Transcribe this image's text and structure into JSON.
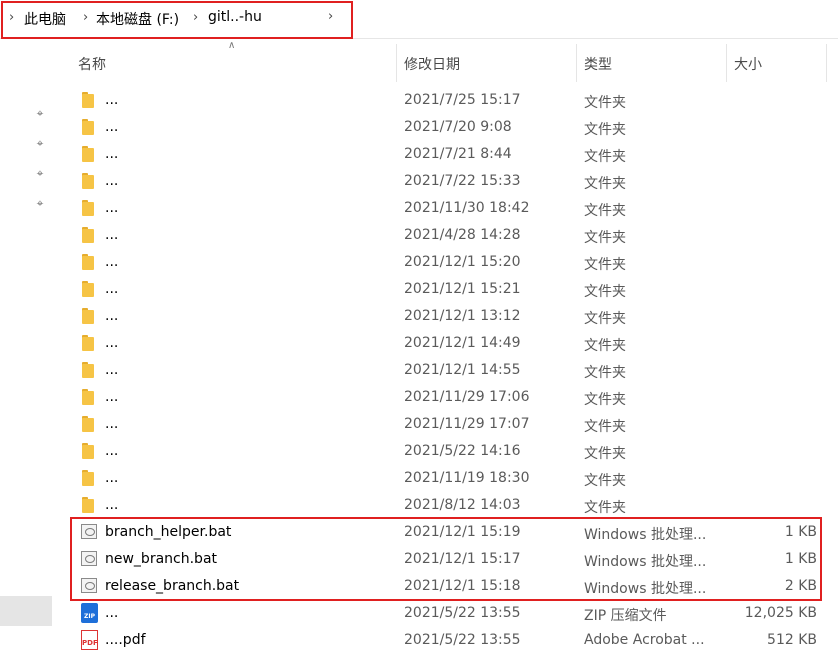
{
  "breadcrumb": {
    "items": [
      "此电脑",
      "本地磁盘 (F:)",
      "gitl..-hu"
    ]
  },
  "columns": {
    "name": "名称",
    "date": "修改日期",
    "type": "类型",
    "size": "大小"
  },
  "files": [
    {
      "name": "...",
      "date": "2021/7/25 15:17",
      "type": "文件夹",
      "size": "",
      "kind": "folder"
    },
    {
      "name": "...",
      "date": "2021/7/20 9:08",
      "type": "文件夹",
      "size": "",
      "kind": "folder"
    },
    {
      "name": "...",
      "date": "2021/7/21 8:44",
      "type": "文件夹",
      "size": "",
      "kind": "folder"
    },
    {
      "name": "...",
      "date": "2021/7/22 15:33",
      "type": "文件夹",
      "size": "",
      "kind": "folder"
    },
    {
      "name": "...",
      "date": "2021/11/30 18:42",
      "type": "文件夹",
      "size": "",
      "kind": "folder"
    },
    {
      "name": "...",
      "date": "2021/4/28 14:28",
      "type": "文件夹",
      "size": "",
      "kind": "folder"
    },
    {
      "name": "...",
      "date": "2021/12/1 15:20",
      "type": "文件夹",
      "size": "",
      "kind": "folder"
    },
    {
      "name": "...",
      "date": "2021/12/1 15:21",
      "type": "文件夹",
      "size": "",
      "kind": "folder"
    },
    {
      "name": "...",
      "date": "2021/12/1 13:12",
      "type": "文件夹",
      "size": "",
      "kind": "folder"
    },
    {
      "name": "...",
      "date": "2021/12/1 14:49",
      "type": "文件夹",
      "size": "",
      "kind": "folder"
    },
    {
      "name": "...",
      "date": "2021/12/1 14:55",
      "type": "文件夹",
      "size": "",
      "kind": "folder"
    },
    {
      "name": "...",
      "date": "2021/11/29 17:06",
      "type": "文件夹",
      "size": "",
      "kind": "folder"
    },
    {
      "name": "...",
      "date": "2021/11/29 17:07",
      "type": "文件夹",
      "size": "",
      "kind": "folder"
    },
    {
      "name": "...",
      "date": "2021/5/22 14:16",
      "type": "文件夹",
      "size": "",
      "kind": "folder"
    },
    {
      "name": "...",
      "date": "2021/11/19 18:30",
      "type": "文件夹",
      "size": "",
      "kind": "folder"
    },
    {
      "name": "...",
      "date": "2021/8/12 14:03",
      "type": "文件夹",
      "size": "",
      "kind": "folder"
    },
    {
      "name": "branch_helper.bat",
      "date": "2021/12/1 15:19",
      "type": "Windows 批处理...",
      "size": "1 KB",
      "kind": "bat"
    },
    {
      "name": "new_branch.bat",
      "date": "2021/12/1 15:17",
      "type": "Windows 批处理...",
      "size": "1 KB",
      "kind": "bat"
    },
    {
      "name": "release_branch.bat",
      "date": "2021/12/1 15:18",
      "type": "Windows 批处理...",
      "size": "2 KB",
      "kind": "bat"
    },
    {
      "name": "...",
      "date": "2021/5/22 13:55",
      "type": "ZIP 压缩文件",
      "size": "12,025 KB",
      "kind": "zip"
    },
    {
      "name": "....pdf",
      "date": "2021/5/22 13:55",
      "type": "Adobe Acrobat ...",
      "size": "512 KB",
      "kind": "pdf"
    }
  ],
  "icons": {
    "chevron": "chevron-right-icon",
    "pin": "pin-icon",
    "folder": "folder-icon",
    "bat": "batch-file-icon",
    "zip": "zip-file-icon",
    "pdf": "pdf-file-icon"
  },
  "accent": {
    "highlight_border": "#e02020",
    "folder": "#f6c445"
  }
}
